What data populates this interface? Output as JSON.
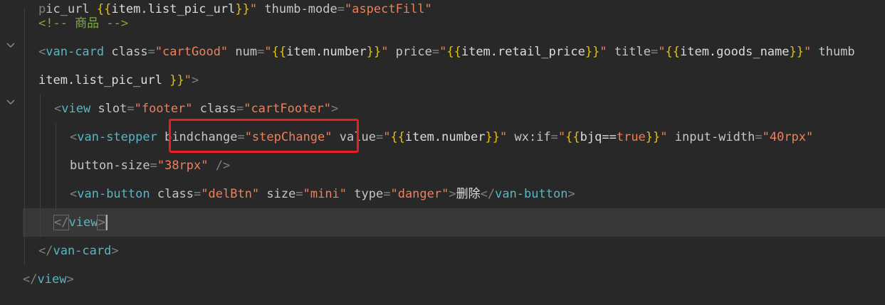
{
  "colors": {
    "background": "#282828",
    "tag": "#56b6c2",
    "attribute": "#c6c6c6",
    "string": "#f07f59",
    "brace": "#e6c000",
    "comment": "#7aad3b",
    "highlight_border": "#e81e25"
  },
  "icons": {
    "fold": "chevron-down-icon"
  },
  "lines": [
    {
      "tokens": [
        {
          "t": "punc",
          "v": "p"
        },
        {
          "t": "attr",
          "v": "ic_url "
        },
        {
          "t": "brace",
          "v": "{{"
        },
        {
          "t": "var",
          "v": "item.list_pic_url"
        },
        {
          "t": "brace",
          "v": "}}"
        },
        {
          "t": "str",
          "v": "\" "
        },
        {
          "t": "attr",
          "v": "thumb-mode"
        },
        {
          "t": "punc",
          "v": "="
        },
        {
          "t": "str",
          "v": "\"aspectFill\""
        },
        {
          "t": "attr",
          "v": " "
        }
      ]
    },
    {
      "tokens": [
        {
          "t": "comment",
          "v": "<!-- 商品 -->"
        }
      ]
    },
    {
      "tokens": [
        {
          "t": "punc",
          "v": "<"
        },
        {
          "t": "tag",
          "v": "van-card"
        },
        {
          "t": "attr",
          "v": " class"
        },
        {
          "t": "punc",
          "v": "="
        },
        {
          "t": "str",
          "v": "\"cartGood\""
        },
        {
          "t": "attr",
          "v": " num"
        },
        {
          "t": "punc",
          "v": "="
        },
        {
          "t": "str",
          "v": "\""
        },
        {
          "t": "brace",
          "v": "{{"
        },
        {
          "t": "var",
          "v": "item.number"
        },
        {
          "t": "brace",
          "v": "}}"
        },
        {
          "t": "str",
          "v": "\""
        },
        {
          "t": "attr",
          "v": " price"
        },
        {
          "t": "punc",
          "v": "="
        },
        {
          "t": "str",
          "v": "\""
        },
        {
          "t": "brace",
          "v": "{{"
        },
        {
          "t": "var",
          "v": "item.retail_price"
        },
        {
          "t": "brace",
          "v": "}}"
        },
        {
          "t": "str",
          "v": "\""
        },
        {
          "t": "attr",
          "v": " title"
        },
        {
          "t": "punc",
          "v": "="
        },
        {
          "t": "str",
          "v": "\""
        },
        {
          "t": "brace",
          "v": "{{"
        },
        {
          "t": "var",
          "v": "item.goods_name"
        },
        {
          "t": "brace",
          "v": "}}"
        },
        {
          "t": "str",
          "v": "\""
        },
        {
          "t": "attr",
          "v": " thumb"
        }
      ]
    },
    {
      "tokens": [
        {
          "t": "var",
          "v": "item.list_pic_url "
        },
        {
          "t": "brace",
          "v": "}}"
        },
        {
          "t": "str",
          "v": "\""
        },
        {
          "t": "punc",
          "v": ">"
        }
      ]
    },
    {
      "tokens": [
        {
          "t": "punc",
          "v": "<"
        },
        {
          "t": "tag",
          "v": "view"
        },
        {
          "t": "attr",
          "v": " slot"
        },
        {
          "t": "punc",
          "v": "="
        },
        {
          "t": "str",
          "v": "\"footer\""
        },
        {
          "t": "attr",
          "v": " class"
        },
        {
          "t": "punc",
          "v": "="
        },
        {
          "t": "str",
          "v": "\"cartFooter\""
        },
        {
          "t": "punc",
          "v": ">"
        }
      ]
    },
    {
      "tokens": [
        {
          "t": "punc",
          "v": "<"
        },
        {
          "t": "tag",
          "v": "van-stepper"
        },
        {
          "t": "attr",
          "v": " bindchange"
        },
        {
          "t": "punc",
          "v": "="
        },
        {
          "t": "str",
          "v": "\"stepChange\""
        },
        {
          "t": "attr",
          "v": " value"
        },
        {
          "t": "punc",
          "v": "="
        },
        {
          "t": "str",
          "v": "\""
        },
        {
          "t": "brace",
          "v": "{{"
        },
        {
          "t": "var",
          "v": "item.number"
        },
        {
          "t": "brace",
          "v": "}}"
        },
        {
          "t": "str",
          "v": "\""
        },
        {
          "t": "attr",
          "v": " wx:if"
        },
        {
          "t": "punc",
          "v": "="
        },
        {
          "t": "str",
          "v": "\""
        },
        {
          "t": "brace",
          "v": "{{"
        },
        {
          "t": "var",
          "v": "bjq=="
        },
        {
          "t": "kw",
          "v": "true"
        },
        {
          "t": "brace",
          "v": "}}"
        },
        {
          "t": "str",
          "v": "\""
        },
        {
          "t": "attr",
          "v": " input-width"
        },
        {
          "t": "punc",
          "v": "="
        },
        {
          "t": "str",
          "v": "\"40rpx\""
        }
      ]
    },
    {
      "tokens": [
        {
          "t": "attr",
          "v": "button-size"
        },
        {
          "t": "punc",
          "v": "="
        },
        {
          "t": "str",
          "v": "\"38rpx\""
        },
        {
          "t": "punc",
          "v": " />"
        }
      ]
    },
    {
      "tokens": [
        {
          "t": "punc",
          "v": "<"
        },
        {
          "t": "tag",
          "v": "van-button"
        },
        {
          "t": "attr",
          "v": " class"
        },
        {
          "t": "punc",
          "v": "="
        },
        {
          "t": "str",
          "v": "\"delBtn\""
        },
        {
          "t": "attr",
          "v": " size"
        },
        {
          "t": "punc",
          "v": "="
        },
        {
          "t": "str",
          "v": "\"mini\""
        },
        {
          "t": "attr",
          "v": " type"
        },
        {
          "t": "punc",
          "v": "="
        },
        {
          "t": "str",
          "v": "\"danger\""
        },
        {
          "t": "punc",
          "v": ">"
        },
        {
          "t": "text",
          "v": "删除"
        },
        {
          "t": "punc",
          "v": "</"
        },
        {
          "t": "tag",
          "v": "van-button"
        },
        {
          "t": "punc",
          "v": ">"
        }
      ]
    },
    {
      "tokens": [
        {
          "t": "punc",
          "v": "</"
        },
        {
          "t": "tag",
          "v": "view"
        },
        {
          "t": "punc",
          "v": ">"
        }
      ]
    },
    {
      "tokens": [
        {
          "t": "punc",
          "v": "</"
        },
        {
          "t": "tag",
          "v": "van-card"
        },
        {
          "t": "punc",
          "v": ">"
        }
      ]
    },
    {
      "tokens": [
        {
          "t": "punc",
          "v": "</"
        },
        {
          "t": "tag",
          "v": "view"
        },
        {
          "t": "punc",
          "v": ">"
        }
      ]
    }
  ]
}
